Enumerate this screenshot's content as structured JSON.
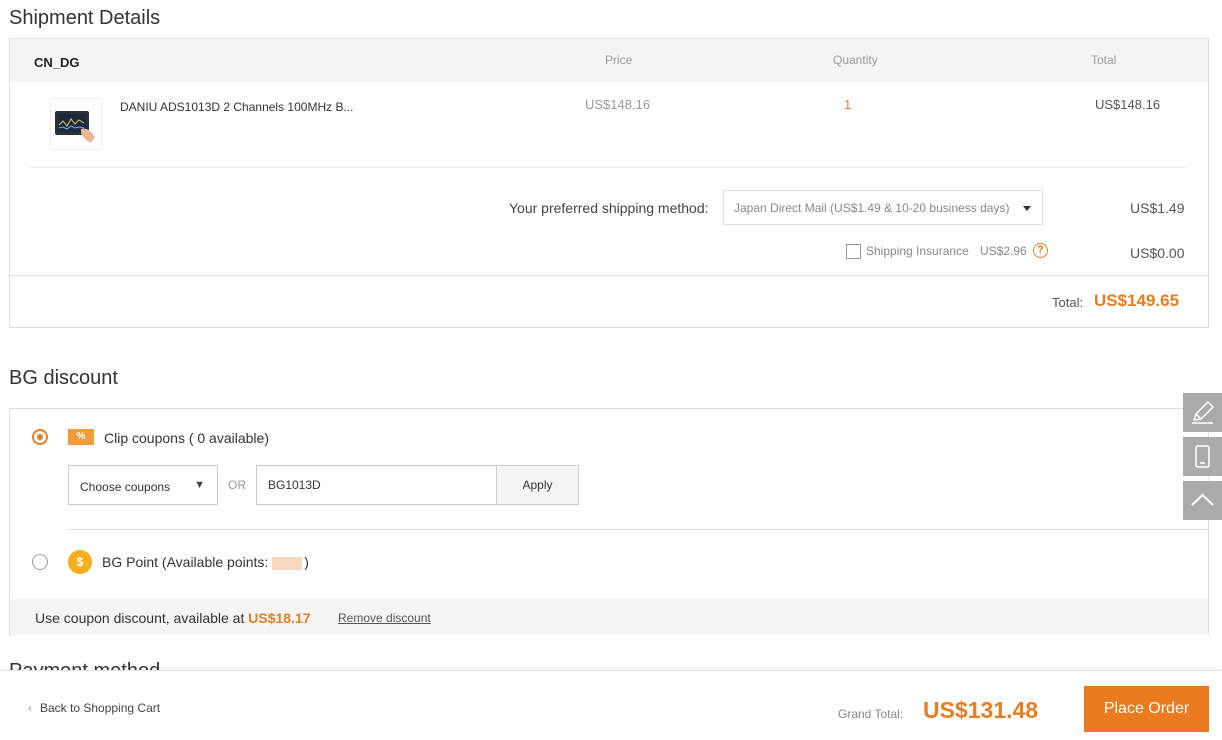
{
  "shipment": {
    "title": "Shipment Details",
    "warehouse": "CN_DG",
    "columns": {
      "price": "Price",
      "quantity": "Quantity",
      "total": "Total"
    },
    "product": {
      "name": "DANIU ADS1013D 2 Channels 100MHz B...",
      "price": "US$148.16",
      "quantity": "1",
      "total": "US$148.16"
    },
    "shipping": {
      "label": "Your preferred shipping method:",
      "selected": "Japan Direct Mail (US$1.49 & 10-20 business days)",
      "cost": "US$1.49"
    },
    "insurance": {
      "label": "Shipping Insurance",
      "price": "US$2.96",
      "help": "?",
      "cost": "US$0.00"
    },
    "total_label": "Total:",
    "total_value": "US$149.65"
  },
  "discount": {
    "title": "BG discount",
    "coupon_icon": "%",
    "coupon_label": "Clip coupons ( 0 available)",
    "coupon_select": "Choose coupons",
    "or": "OR",
    "coupon_code": "BG1013D",
    "apply": "Apply",
    "point_icon": "$",
    "point_label_prefix": "BG Point (Available points:",
    "point_label_suffix": ")",
    "summary_prefix": "Use coupon discount, available at ",
    "summary_amount": "US$18.17",
    "remove": "Remove discount"
  },
  "next_section_title": "Payment method",
  "footer": {
    "back": "Back to Shopping Cart",
    "grand_label": "Grand Total:",
    "grand_value": "US$131.48",
    "place_order": "Place Order"
  },
  "side_tools": [
    "pencil-icon",
    "phone-icon",
    "chevron-up-icon"
  ],
  "colors": {
    "accent": "#ec7a1f",
    "price_orange": "#e67e22"
  }
}
